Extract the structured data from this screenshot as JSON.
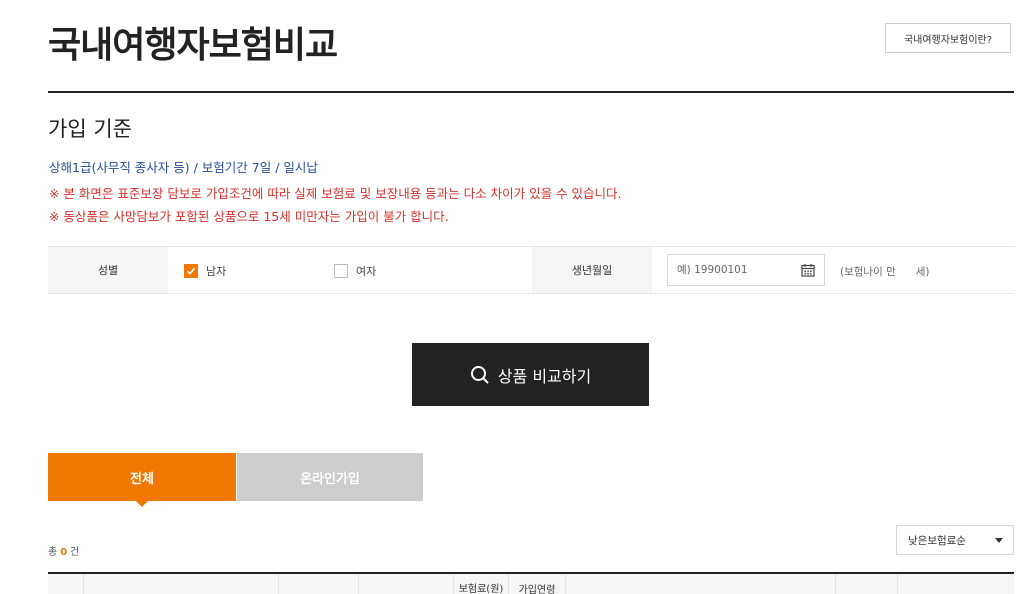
{
  "header": {
    "title": "국내여행자보험비교",
    "info_button": "국내여행자보험이란?"
  },
  "criteria": {
    "heading": "가입 기준",
    "summary": "상해1급(사무직 종사자 등) / 보험기간 7일 / 일시납",
    "notice_1": "※ 본 화면은 표준보장 담보로 가입조건에 따라 실제 보험료 및 보장내용 등과는 다소 차이가 있을 수 있습니다.",
    "notice_2": "※ 동상품은 사망담보가 포함된 상품으로 15세 미만자는 가입이 불가 합니다."
  },
  "form": {
    "gender_label": "성별",
    "male_label": "남자",
    "male_checked": true,
    "female_label": "여자",
    "female_checked": false,
    "birth_label": "생년월일",
    "birth_placeholder": "예) 19900101",
    "birth_value": "",
    "age_note": "(보험나이 만      세)"
  },
  "compare_button": "상품 비교하기",
  "tabs": [
    {
      "label": "전체",
      "active": true
    },
    {
      "label": "온라인가입",
      "active": false
    }
  ],
  "results": {
    "total_prefix": "총",
    "total_count": "0",
    "total_suffix": "건",
    "sort_selected": "낮은보험료순"
  },
  "table": {
    "premium_header": "보험료(원)",
    "age_header": "가입연령"
  },
  "colors": {
    "accent": "#f07800",
    "notice": "#d9302c",
    "criteria": "#2a4d9a",
    "button_dark": "#222222"
  }
}
